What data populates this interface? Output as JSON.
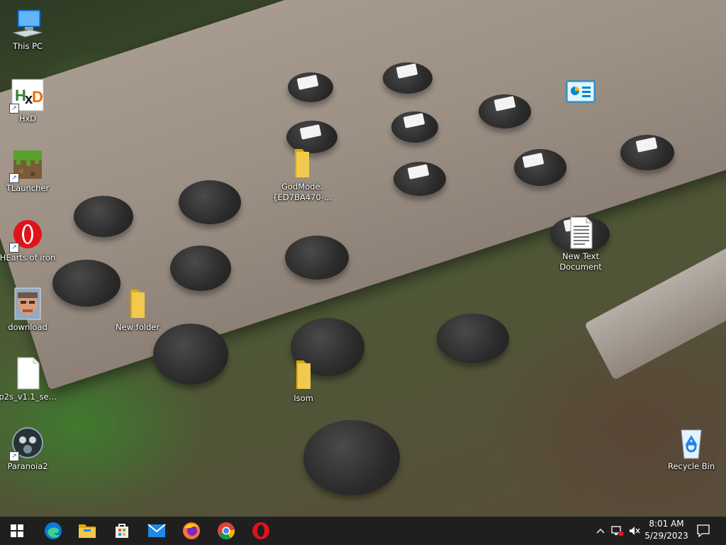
{
  "desktop": {
    "icons": [
      {
        "label": "This PC"
      },
      {
        "label": "HxD"
      },
      {
        "label": "TLauncher"
      },
      {
        "label": "HEarts of iron"
      },
      {
        "label": "download"
      },
      {
        "label": "p2s_v1.1_se..."
      },
      {
        "label": "Paranoia2"
      },
      {
        "label": "GodMode.{ED7BA470-..."
      },
      {
        "label": "New folder"
      },
      {
        "label": "Isom"
      },
      {
        "label": "New Text Document"
      },
      {
        "label": "Recycle Bin"
      }
    ]
  },
  "taskbar": {
    "pinned": [
      "windows-start",
      "edge",
      "file-explorer",
      "microsoft-store",
      "mail",
      "firefox",
      "chrome",
      "opera"
    ],
    "clock": {
      "time": "8:01 AM",
      "date": "5/29/2023"
    }
  },
  "colors": {
    "taskbar": "#1f1f1f",
    "folder": "#f2c94c",
    "accent": "#0078d4"
  }
}
